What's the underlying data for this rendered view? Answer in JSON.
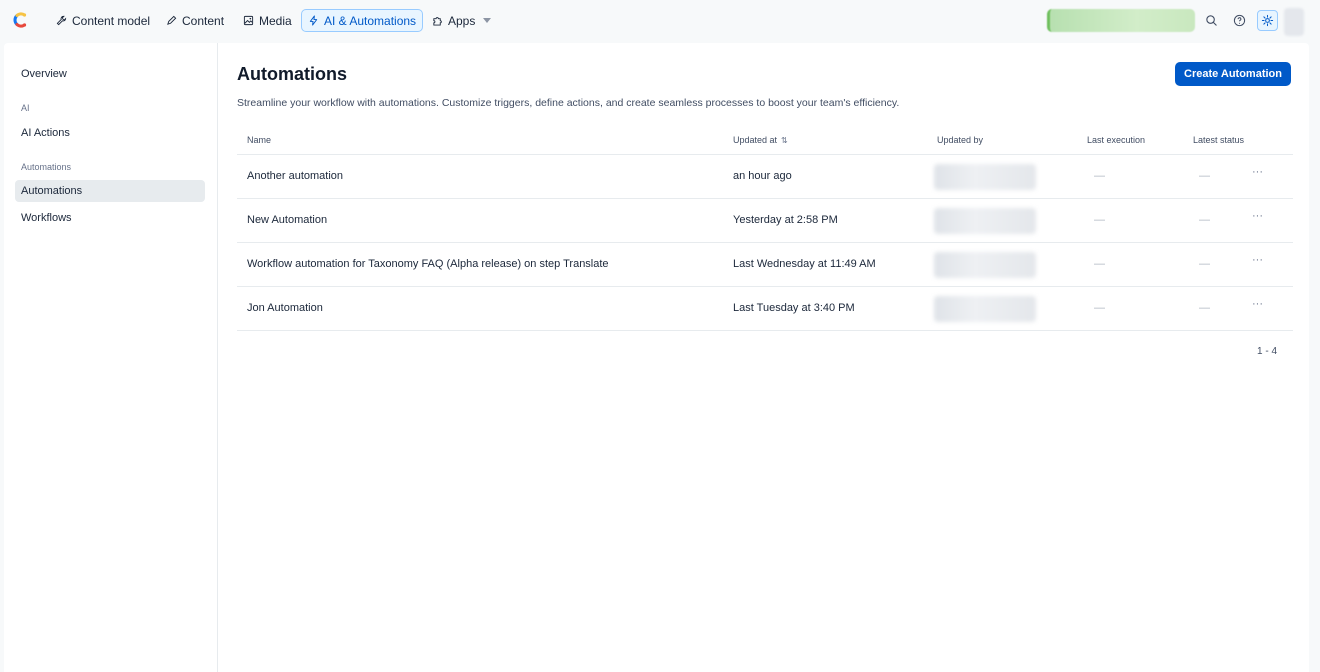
{
  "nav": {
    "items": [
      {
        "label": "Content model",
        "icon": "wrench-icon"
      },
      {
        "label": "Content",
        "icon": "pen-icon"
      },
      {
        "label": "Media",
        "icon": "image-icon"
      },
      {
        "label": "AI & Automations",
        "icon": "lightning-icon"
      },
      {
        "label": "Apps",
        "icon": "puzzle-icon"
      }
    ],
    "active": "AI & Automations"
  },
  "sidebar": {
    "overview": "Overview",
    "section_ai": "AI",
    "ai_actions": "AI Actions",
    "section_automations": "Automations",
    "automations": "Automations",
    "workflows": "Workflows"
  },
  "page": {
    "title": "Automations",
    "subtitle": "Streamline your workflow with automations. Customize triggers, define actions, and create seamless processes to boost your team's efficiency.",
    "create_button": "Create Automation"
  },
  "table": {
    "columns": {
      "name": "Name",
      "updated_at": "Updated at",
      "updated_by": "Updated by",
      "last_execution": "Last execution",
      "latest_status": "Latest status"
    },
    "rows": [
      {
        "name": "Another automation",
        "updated_at": "an hour ago",
        "last_execution": "—",
        "latest_status": "—"
      },
      {
        "name": "New Automation",
        "updated_at": "Yesterday at 2:58 PM",
        "last_execution": "—",
        "latest_status": "—"
      },
      {
        "name": "Workflow automation for Taxonomy FAQ (Alpha release) on step Translate",
        "updated_at": "Last Wednesday at 11:49 AM",
        "last_execution": "—",
        "latest_status": "—"
      },
      {
        "name": "Jon Automation",
        "updated_at": "Last Tuesday at 3:40 PM",
        "last_execution": "—",
        "latest_status": "—"
      }
    ],
    "more_label": "···"
  },
  "pagination": "1 - 4",
  "colors": {
    "primary": "#0059c8",
    "active_nav_bg": "#e8f5ff",
    "active_nav_border": "#98cbff",
    "text": "#1b273a"
  }
}
